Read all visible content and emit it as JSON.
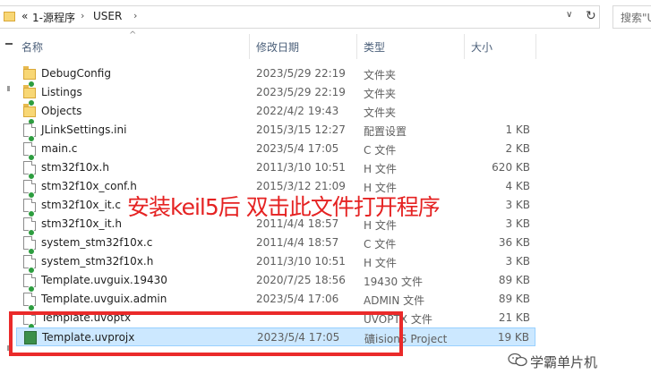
{
  "address": {
    "back_chevrons": "«",
    "crumbs": [
      "1-源程序",
      "USER"
    ],
    "separator": "›",
    "dropdown": "∨",
    "refresh": "↻"
  },
  "search": {
    "placeholder": "搜索\"USER\""
  },
  "columns": {
    "name": "名称",
    "date": "修改日期",
    "type": "类型",
    "size": "大小",
    "sort_arrow": "^"
  },
  "files": [
    {
      "name": "DebugConfig",
      "date": "2023/5/29 22:19",
      "type": "文件夹",
      "size": "",
      "icon": "folder"
    },
    {
      "name": "Listings",
      "date": "2023/5/29 22:19",
      "type": "文件夹",
      "size": "",
      "icon": "folder"
    },
    {
      "name": "Objects",
      "date": "2022/4/2 19:43",
      "type": "文件夹",
      "size": "",
      "icon": "folder"
    },
    {
      "name": "JLinkSettings.ini",
      "date": "2015/3/15 12:27",
      "type": "配置设置",
      "size": "1 KB",
      "icon": "file"
    },
    {
      "name": "main.c",
      "date": "2023/5/4 17:05",
      "type": "C 文件",
      "size": "2 KB",
      "icon": "file"
    },
    {
      "name": "stm32f10x.h",
      "date": "2011/3/10 10:51",
      "type": "H 文件",
      "size": "620 KB",
      "icon": "file"
    },
    {
      "name": "stm32f10x_conf.h",
      "date": "2015/3/12 21:09",
      "type": "H 文件",
      "size": "4 KB",
      "icon": "file"
    },
    {
      "name": "stm32f10x_it.c",
      "date": "",
      "type": "",
      "size": "3 KB",
      "icon": "file"
    },
    {
      "name": "stm32f10x_it.h",
      "date": "2011/4/4 18:57",
      "type": "H 文件",
      "size": "3 KB",
      "icon": "file"
    },
    {
      "name": "system_stm32f10x.c",
      "date": "2011/4/4 18:57",
      "type": "C 文件",
      "size": "36 KB",
      "icon": "file"
    },
    {
      "name": "system_stm32f10x.h",
      "date": "2011/3/10 10:51",
      "type": "H 文件",
      "size": "3 KB",
      "icon": "file"
    },
    {
      "name": "Template.uvguix.19430",
      "date": "2020/7/25 18:56",
      "type": "19430 文件",
      "size": "89 KB",
      "icon": "file"
    },
    {
      "name": "Template.uvguix.admin",
      "date": "2023/5/4 17:06",
      "type": "ADMIN 文件",
      "size": "89 KB",
      "icon": "file"
    },
    {
      "name": "Template.uvoptx",
      "date": "",
      "type": "UVOPTX 文件",
      "size": "21 KB",
      "icon": "file"
    },
    {
      "name": "Template.uvprojx",
      "date": "2023/5/4 17:05",
      "type": "礦ision5 Project",
      "size": "19 KB",
      "icon": "uv"
    }
  ],
  "selected_row": "Template.uvprojx",
  "annotation": "安装keil5后 双击此文件打开程序",
  "watermark": "学霸单片机",
  "colors": {
    "annotation": "#e52222",
    "selection": "#cce8ff",
    "highlight_box": "#ea2a2a"
  }
}
